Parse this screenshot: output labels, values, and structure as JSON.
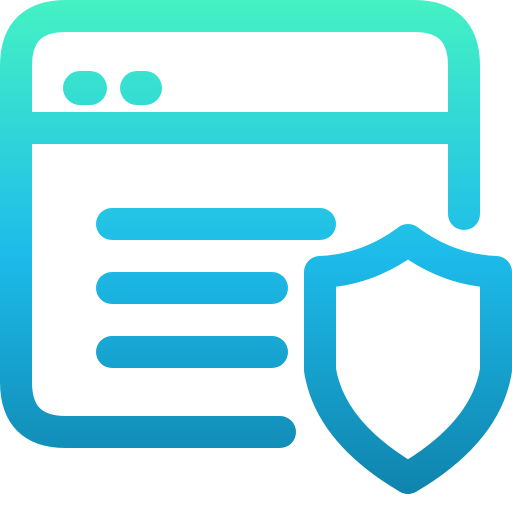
{
  "icon": {
    "name": "secure-browser-shield-icon",
    "parts": [
      "browser-window-icon",
      "window-dots",
      "content-lines",
      "shield-icon"
    ]
  },
  "colors": {
    "gradient_top": "#44F2C3",
    "gradient_mid": "#1DBBEA",
    "gradient_bottom": "#0E7FA8",
    "background": "#FFFFFF"
  }
}
